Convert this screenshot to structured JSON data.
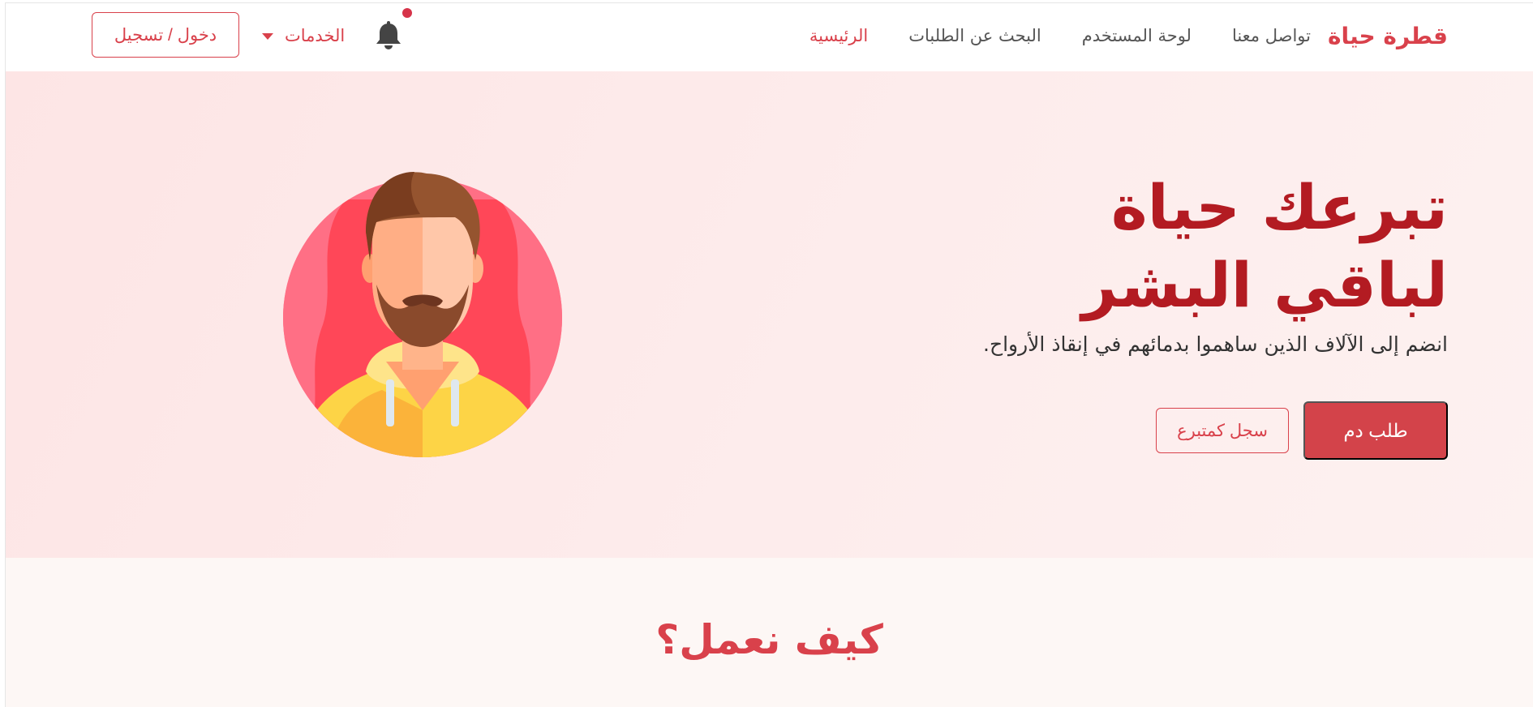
{
  "navbar": {
    "brand": "قطرة حياة",
    "links": [
      {
        "label": "الرئيسية",
        "active": true
      },
      {
        "label": "البحث عن الطلبات",
        "active": false
      },
      {
        "label": "لوحة المستخدم",
        "active": false
      },
      {
        "label": "تواصل معنا",
        "active": false
      }
    ],
    "notification_icon": "bell-icon",
    "has_notification": true,
    "services_label": "الخدمات",
    "login_label": "دخول / تسجيل"
  },
  "hero": {
    "title_line1": "تبرعك حياة",
    "title_line2": "لباقي البشر",
    "subtitle": "انضم إلى الآلاف الذين ساهموا بدمائهم في إنقاذ الأرواح.",
    "primary_button": "طلب دم",
    "secondary_button": "سجل كمتبرع",
    "illustration": "bearded-man-avatar"
  },
  "how_section": {
    "title": "كيف نعمل؟"
  },
  "colors": {
    "accent": "#d9414b",
    "title": "#b31b22",
    "hero_bg": "#fde8e8",
    "section_bg": "#fdf7f5"
  }
}
